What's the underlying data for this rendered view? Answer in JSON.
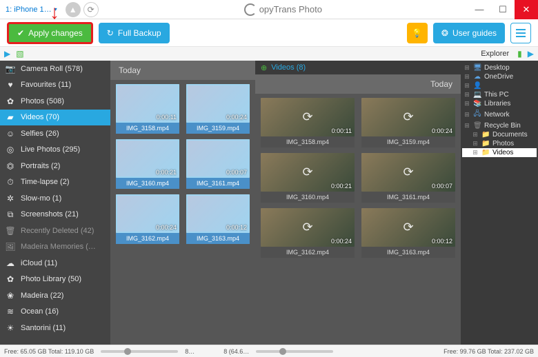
{
  "titlebar": {
    "device": "1: iPhone 1…",
    "app_name": "opyTrans Photo"
  },
  "toolbar": {
    "apply": "Apply changes",
    "backup": "Full Backup",
    "guides": "User guides"
  },
  "explorer_label": "Explorer",
  "sidebar": [
    {
      "icon": "📷",
      "label": "Camera Roll (578)"
    },
    {
      "icon": "♥",
      "label": "Favourites (11)"
    },
    {
      "icon": "✿",
      "label": "Photos (508)"
    },
    {
      "icon": "▰",
      "label": "Videos (70)",
      "active": true
    },
    {
      "icon": "☺",
      "label": "Selfies (26)"
    },
    {
      "icon": "◎",
      "label": "Live Photos (295)"
    },
    {
      "icon": "⏣",
      "label": "Portraits (2)"
    },
    {
      "icon": "⏱",
      "label": "Time-lapse (2)"
    },
    {
      "icon": "✲",
      "label": "Slow-mo (1)"
    },
    {
      "icon": "⧉",
      "label": "Screenshots (21)"
    },
    {
      "icon": "🗑",
      "label": "Recently Deleted (42)",
      "muted": true
    },
    {
      "icon": "🖼",
      "label": "Madeira Memories (…",
      "muted": true
    },
    {
      "icon": "☁",
      "label": "iCloud (11)"
    },
    {
      "icon": "✿",
      "label": "Photo Library (50)"
    },
    {
      "icon": "❀",
      "label": "Madeira (22)"
    },
    {
      "icon": "≋",
      "label": "Ocean (16)"
    },
    {
      "icon": "☀",
      "label": "Santorini (11)"
    }
  ],
  "left_panel": {
    "header": "Today",
    "items": [
      {
        "dur": "0:00:11",
        "name": "IMG_3158.mp4",
        "sel": true
      },
      {
        "dur": "0:00:24",
        "name": "IMG_3159.mp4",
        "sel": true
      },
      {
        "dur": "0:00:21",
        "name": "IMG_3160.mp4",
        "sel": true
      },
      {
        "dur": "0:00:07",
        "name": "IMG_3161.mp4",
        "sel": true
      },
      {
        "dur": "0:00:24",
        "name": "IMG_3162.mp4",
        "sel": true
      },
      {
        "dur": "0:00:12",
        "name": "IMG_3163.mp4",
        "sel": true
      }
    ]
  },
  "right_panel": {
    "tab": "Videos (8)",
    "header": "Today",
    "items": [
      {
        "dur": "0:00:11",
        "name": "IMG_3158.mp4",
        "sync": true
      },
      {
        "dur": "0:00:24",
        "name": "IMG_3159.mp4",
        "sync": true
      },
      {
        "dur": "0:00:21",
        "name": "IMG_3160.mp4",
        "sync": true
      },
      {
        "dur": "0:00:07",
        "name": "IMG_3161.mp4",
        "sync": true
      },
      {
        "dur": "0:00:24",
        "name": "IMG_3162.mp4",
        "sync": true
      },
      {
        "dur": "0:00:12",
        "name": "IMG_3163.mp4",
        "sync": true
      }
    ]
  },
  "explorer": [
    {
      "icon": "🖥",
      "label": "Desktop",
      "c": "#5aa0e0"
    },
    {
      "icon": "☁",
      "label": "OneDrive",
      "c": "#5aa0e0"
    },
    {
      "icon": "👤",
      "label": "",
      "c": "#888"
    },
    {
      "icon": "💻",
      "label": "This PC",
      "c": "#5aa0e0"
    },
    {
      "icon": "📚",
      "label": "Libraries",
      "c": "#e0a030"
    },
    {
      "icon": "🖧",
      "label": "Network",
      "c": "#5aa0e0"
    },
    {
      "icon": "🗑",
      "label": "Recycle Bin",
      "c": "#888"
    },
    {
      "icon": "📁",
      "label": "Documents",
      "c": "#e0a030"
    },
    {
      "icon": "📁",
      "label": "Photos",
      "c": "#e0a030"
    },
    {
      "icon": "📁",
      "label": "Videos",
      "c": "#e0a030",
      "sel": true
    }
  ],
  "status": {
    "left": "Free: 65.05 GB Total: 119.10 GB",
    "mid": "8…",
    "mid2": "8 (64.6…",
    "right": "Free: 99.76 GB Total: 237.02 GB"
  }
}
